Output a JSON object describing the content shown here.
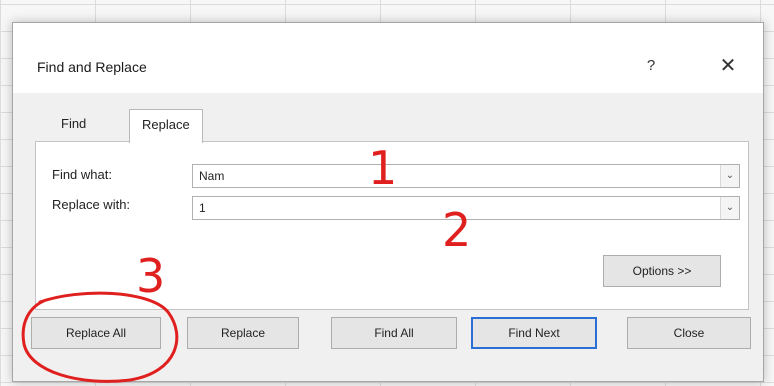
{
  "dialog": {
    "title": "Find and Replace",
    "help_label": "?",
    "close_label": "✕"
  },
  "tabs": [
    {
      "label": "Find",
      "active": false
    },
    {
      "label": "Replace",
      "active": true
    }
  ],
  "find_what": {
    "label": "Find what:",
    "value": "Nam"
  },
  "replace_with": {
    "label": "Replace with:",
    "value": "1"
  },
  "dropdown_arrow": "⌄",
  "buttons": {
    "options": "Options >>",
    "replace_all": "Replace All",
    "replace": "Replace",
    "find_all": "Find All",
    "find_next": "Find Next",
    "close": "Close"
  },
  "annotations": {
    "color": "#e01f1f",
    "labels": [
      "1",
      "2",
      "3"
    ]
  }
}
